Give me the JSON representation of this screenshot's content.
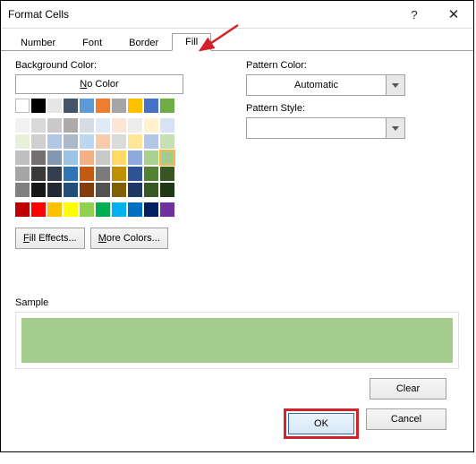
{
  "window": {
    "title": "Format Cells"
  },
  "tabs": [
    "Number",
    "Font",
    "Border",
    "Fill"
  ],
  "active_tab": 3,
  "left": {
    "bg_label": "Background Color:",
    "no_color": "No Color",
    "row1": [
      "#ffffff00",
      "#000000",
      "#e7e6e6",
      "#44546a",
      "#5b9bd5",
      "#ed7d31",
      "#a5a5a5",
      "#ffc000",
      "#4472c4",
      "#70ad47"
    ],
    "tint_rows": [
      [
        "#f2f2f2",
        "#d9d9d9",
        "#c9c9c9",
        "#aeaaaa",
        "#d6dce4",
        "#deebf7",
        "#fbe5d6",
        "#ededed",
        "#fff2cc",
        "#d9e2f3"
      ],
      [
        "#e7f0da",
        "#d0cece",
        "#b4c6e7",
        "#acb9ca",
        "#bdd7ee",
        "#f8cbad",
        "#dbdbdb",
        "#ffe699",
        "#b4c6e7",
        "#c5e0b3"
      ],
      [
        "#bfbfbf",
        "#757171",
        "#8497b0",
        "#9cc2e5",
        "#f4b084",
        "#c9c9c9",
        "#ffd966",
        "#8eaadb",
        "#a9d08e",
        "#a4cd8d"
      ],
      [
        "#a6a6a6",
        "#3a3838",
        "#333f4f",
        "#2f75b5",
        "#c65911",
        "#7b7b7b",
        "#bf8f00",
        "#2f5496",
        "#548235",
        "#375623"
      ],
      [
        "#808080",
        "#171717",
        "#222b35",
        "#1f4e78",
        "#833c0c",
        "#525252",
        "#806000",
        "#1f3864",
        "#385723",
        "#203714"
      ]
    ],
    "standard_row": [
      "#c00000",
      "#ff0000",
      "#ffc000",
      "#ffff00",
      "#92d050",
      "#00b050",
      "#00b0f0",
      "#0070c0",
      "#002060",
      "#7030a0"
    ],
    "selected": [
      2,
      9
    ],
    "fill_effects": "Fill Effects...",
    "more_colors": "More Colors..."
  },
  "right": {
    "pattern_color_label": "Pattern Color:",
    "pattern_color_value": "Automatic",
    "pattern_style_label": "Pattern Style:"
  },
  "sample": {
    "label": "Sample",
    "color": "#a4cd8d"
  },
  "buttons": {
    "clear": "Clear",
    "ok": "OK",
    "cancel": "Cancel"
  }
}
